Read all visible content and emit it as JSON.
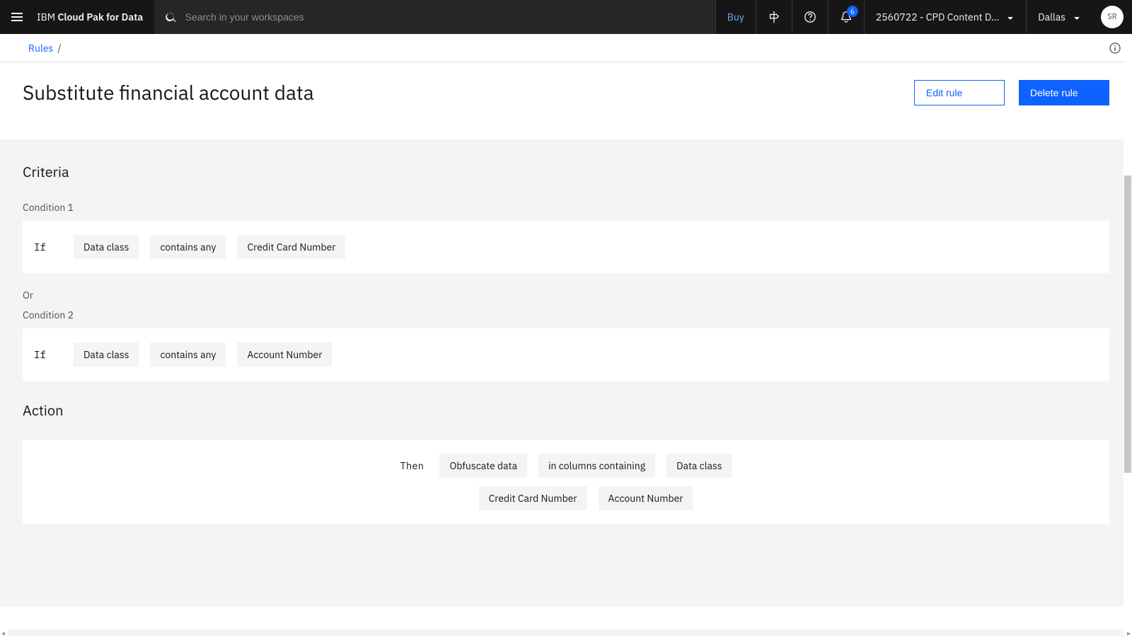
{
  "header": {
    "brand_prefix": "IBM",
    "brand_name": "Cloud Pak for Data",
    "search_placeholder": "Search in your workspaces",
    "buy_label": "Buy",
    "notification_count": "6",
    "account_label": "2560722 - CPD Content D...",
    "region_label": "Dallas",
    "avatar_initials": "SR"
  },
  "breadcrumb": {
    "root": "Rules",
    "sep": "/"
  },
  "page": {
    "title": "Substitute financial account data",
    "edit_label": "Edit rule",
    "delete_label": "Delete rule"
  },
  "criteria": {
    "heading": "Criteria",
    "condition1_label": "Condition 1",
    "condition1_prefix": "If",
    "condition1_pills": [
      "Data class",
      "contains any",
      "Credit Card Number"
    ],
    "or_label": "Or",
    "condition2_label": "Condition 2",
    "condition2_prefix": "If",
    "condition2_pills": [
      "Data class",
      "contains any",
      "Account Number"
    ]
  },
  "action": {
    "heading": "Action",
    "prefix": "Then",
    "row1_pills": [
      "Obfuscate data",
      "in columns containing",
      "Data class"
    ],
    "row2_pills": [
      "Credit Card Number",
      "Account Number"
    ]
  }
}
